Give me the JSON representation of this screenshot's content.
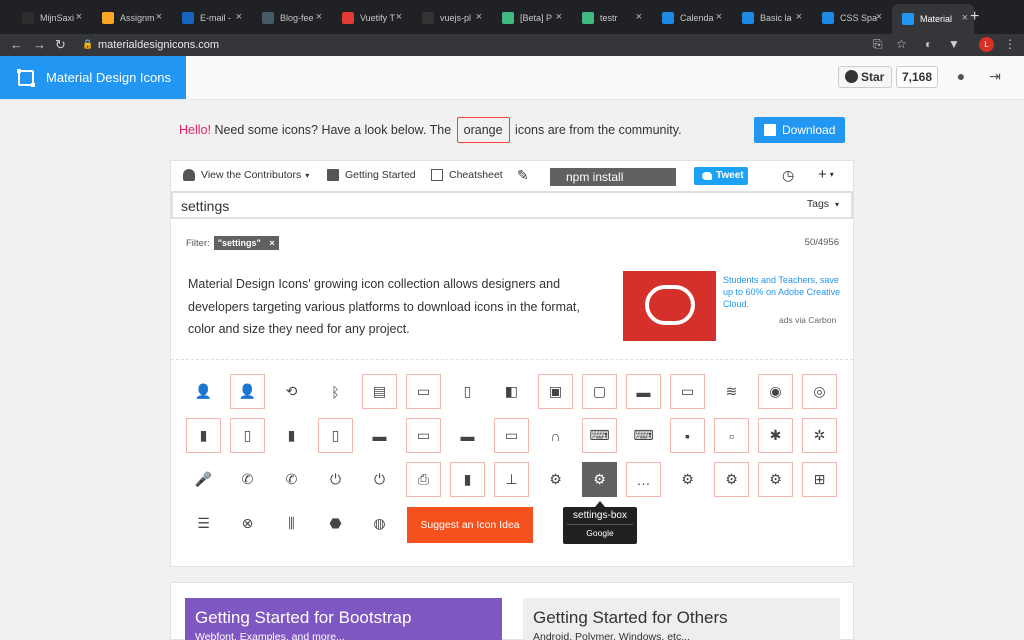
{
  "browser": {
    "tabs": [
      {
        "label": "MijnSaxi",
        "color": "#2d2d2d"
      },
      {
        "label": "Assignm",
        "color": "#f9a825"
      },
      {
        "label": "E-mail -",
        "color": "#1565c0"
      },
      {
        "label": "Blog-fee",
        "color": "#455a64"
      },
      {
        "label": "Vuetify T",
        "color": "#e53935"
      },
      {
        "label": "vuejs-pl",
        "color": "#333333"
      },
      {
        "label": "[Beta] P",
        "color": "#42b883"
      },
      {
        "label": "testr",
        "color": "#42b883"
      },
      {
        "label": "Calenda",
        "color": "#1e88e5"
      },
      {
        "label": "Basic la",
        "color": "#1e88e5"
      },
      {
        "label": "CSS Spa",
        "color": "#1e88e5"
      },
      {
        "label": "Material",
        "color": "#2196f3"
      }
    ],
    "new_tab": "+",
    "url": "materialdesignicons.com",
    "profile_initial": "L"
  },
  "appbar": {
    "brand": "Material Design Icons",
    "star_label": "Star",
    "star_count": "7,168"
  },
  "banner": {
    "hello": "Hello!",
    "before": " Need some icons? Have a look below. The ",
    "orange": "orange",
    "after": " icons are from the community.",
    "download": "Download"
  },
  "toolbar": {
    "contributors": "View the Contributors",
    "getting_started": "Getting Started",
    "cheatsheet": "Cheatsheet",
    "npm": "npm install @mdi/font",
    "tweet": "Tweet"
  },
  "search": {
    "value": "settings",
    "tags": "Tags"
  },
  "filter": {
    "label": "Filter:",
    "chip": "\"settings\"",
    "count": "50/4956"
  },
  "description": "Material Design Icons' growing icon collection allows designers and developers targeting various platforms to download icons in the format, color and size they need for any project.",
  "ad": {
    "text": "Students and Teachers, save up to 60% on Adobe Creative Cloud.",
    "via": "ads via Carbon"
  },
  "icons": [
    {
      "name": "account-settings-icon",
      "glyph": "👤",
      "orange": false
    },
    {
      "name": "account-settings-outline-icon",
      "glyph": "👤",
      "orange": true
    },
    {
      "name": "backup-restore-icon",
      "glyph": "⟲",
      "orange": false
    },
    {
      "name": "bluetooth-settings-icon",
      "glyph": "ᛒ",
      "orange": false
    },
    {
      "name": "card-settings-icon",
      "glyph": "▤",
      "orange": true
    },
    {
      "name": "card-settings-outline-icon",
      "glyph": "▭",
      "orange": true
    },
    {
      "name": "cellphone-settings-icon",
      "glyph": "▯",
      "orange": false
    },
    {
      "name": "cellphone-settings-variant-icon",
      "glyph": "◧",
      "orange": false
    },
    {
      "name": "content-save-settings-icon",
      "glyph": "▣",
      "orange": true
    },
    {
      "name": "content-save-settings-outline-icon",
      "glyph": "▢",
      "orange": true
    },
    {
      "name": "credit-card-settings-icon",
      "glyph": "▬",
      "orange": true
    },
    {
      "name": "credit-card-settings-outline-icon",
      "glyph": "▭",
      "orange": true
    },
    {
      "name": "database-settings-icon",
      "glyph": "≋",
      "orange": false
    },
    {
      "name": "eye-settings-icon",
      "glyph": "◉",
      "orange": true
    },
    {
      "name": "eye-settings-outline-icon",
      "glyph": "◎",
      "orange": true
    },
    {
      "name": "file-settings-icon",
      "glyph": "▮",
      "orange": true
    },
    {
      "name": "file-settings-outline-icon",
      "glyph": "▯",
      "orange": true
    },
    {
      "name": "file-settings-variant-icon",
      "glyph": "▮",
      "orange": false
    },
    {
      "name": "file-settings-variant-outline-icon",
      "glyph": "▯",
      "orange": true
    },
    {
      "name": "folder-settings-icon",
      "glyph": "▬",
      "orange": false
    },
    {
      "name": "folder-settings-outline-icon",
      "glyph": "▭",
      "orange": true
    },
    {
      "name": "folder-settings-variant-icon",
      "glyph": "▬",
      "orange": false
    },
    {
      "name": "folder-settings-variant-outline-icon",
      "glyph": "▭",
      "orange": true
    },
    {
      "name": "headphones-settings-icon",
      "glyph": "∩",
      "orange": false
    },
    {
      "name": "keyboard-settings-icon",
      "glyph": "⌨",
      "orange": true
    },
    {
      "name": "keyboard-settings-outline-icon",
      "glyph": "⌨",
      "orange": false
    },
    {
      "name": "message-settings-icon",
      "glyph": "▪",
      "orange": true
    },
    {
      "name": "message-settings-outline-icon",
      "glyph": "▫",
      "orange": true
    },
    {
      "name": "message-settings-variant-icon",
      "glyph": "✱",
      "orange": true
    },
    {
      "name": "message-settings-variant-outline-icon",
      "glyph": "✲",
      "orange": true
    },
    {
      "name": "microphone-settings-icon",
      "glyph": "🎤",
      "orange": false
    },
    {
      "name": "phone-settings-icon",
      "glyph": "✆",
      "orange": false
    },
    {
      "name": "phone-settings-outline-icon",
      "glyph": "✆",
      "orange": false
    },
    {
      "name": "power-settings-icon",
      "glyph": "⏻",
      "orange": false
    },
    {
      "name": "power-settings-variant-icon",
      "glyph": "⏻",
      "orange": false
    },
    {
      "name": "printer-settings-icon",
      "glyph": "⎙",
      "orange": true
    },
    {
      "name": "remote-settings-icon",
      "glyph": "▮",
      "orange": true
    },
    {
      "name": "router-wireless-settings-icon",
      "glyph": "⊥",
      "orange": true
    },
    {
      "name": "settings-icon",
      "glyph": "⚙",
      "orange": false
    },
    {
      "name": "settings-box-icon",
      "glyph": "⚙",
      "orange": false,
      "selected": true
    },
    {
      "name": "settings-helper-icon",
      "glyph": "…",
      "orange": true
    },
    {
      "name": "settings-outline-icon",
      "glyph": "⚙",
      "orange": false
    },
    {
      "name": "settings-transfer-icon",
      "glyph": "⚙",
      "orange": true
    },
    {
      "name": "settings-transfer-outline-icon",
      "glyph": "⚙",
      "orange": true
    },
    {
      "name": "table-settings-icon",
      "glyph": "⊞",
      "orange": true
    },
    {
      "name": "tune-icon",
      "glyph": "☰",
      "orange": false
    },
    {
      "name": "access-point-settings-icon",
      "glyph": "⊗",
      "orange": false
    },
    {
      "name": "tune-vertical-icon",
      "glyph": "⫼",
      "orange": false
    },
    {
      "name": "video-input-component-icon",
      "glyph": "⬣",
      "orange": false
    },
    {
      "name": "palette-settings-icon",
      "glyph": "◍",
      "orange": false
    }
  ],
  "suggest": "Suggest an Icon Idea",
  "tooltip": {
    "name": "settings-box",
    "author": "Google"
  },
  "panels": {
    "bootstrap_title": "Getting Started for Bootstrap",
    "bootstrap_sub": "Webfont, Examples, and more...",
    "others_title": "Getting Started for Others",
    "others_sub": "Android, Polymer, Windows, etc..."
  },
  "colors": {
    "primary": "#2196f3",
    "accent_orange": "#f4511e",
    "hello": "#e91e63",
    "ad_red": "#d6302a",
    "bootstrap_purple": "#7e57c2"
  }
}
